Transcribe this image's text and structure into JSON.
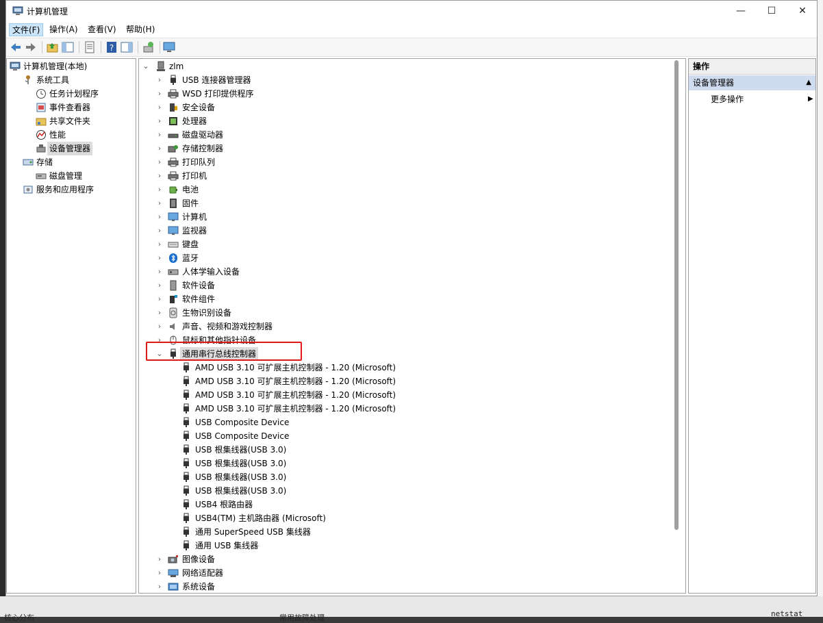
{
  "window": {
    "title": "计算机管理"
  },
  "menu": [
    "文件(F)",
    "操作(A)",
    "查看(V)",
    "帮助(H)"
  ],
  "left_tree": [
    {
      "label": "计算机管理(本地)",
      "indent": 0,
      "arrow": "",
      "icon": "computer-management-icon"
    },
    {
      "label": "系统工具",
      "indent": 1,
      "arrow": "⌄",
      "icon": "tools-icon"
    },
    {
      "label": "任务计划程序",
      "indent": 2,
      "arrow": "›",
      "icon": "clock-icon"
    },
    {
      "label": "事件查看器",
      "indent": 2,
      "arrow": "›",
      "icon": "event-viewer-icon"
    },
    {
      "label": "共享文件夹",
      "indent": 2,
      "arrow": "›",
      "icon": "shared-folder-icon"
    },
    {
      "label": "性能",
      "indent": 2,
      "arrow": "›",
      "icon": "performance-icon"
    },
    {
      "label": "设备管理器",
      "indent": 2,
      "arrow": "",
      "icon": "device-manager-icon",
      "selected": true
    },
    {
      "label": "存储",
      "indent": 1,
      "arrow": "⌄",
      "icon": "storage-icon"
    },
    {
      "label": "磁盘管理",
      "indent": 2,
      "arrow": "",
      "icon": "disk-management-icon"
    },
    {
      "label": "服务和应用程序",
      "indent": 1,
      "arrow": "›",
      "icon": "services-icon"
    }
  ],
  "device_tree": [
    {
      "label": "zlm",
      "level": 0,
      "arrow": "⌄",
      "icon": "computer-icon"
    },
    {
      "label": "USB 连接器管理器",
      "level": 1,
      "arrow": "›",
      "icon": "usb-icon"
    },
    {
      "label": "WSD 打印提供程序",
      "level": 1,
      "arrow": "›",
      "icon": "printer-icon"
    },
    {
      "label": "安全设备",
      "level": 1,
      "arrow": "›",
      "icon": "security-device-icon"
    },
    {
      "label": "处理器",
      "level": 1,
      "arrow": "›",
      "icon": "processor-icon"
    },
    {
      "label": "磁盘驱动器",
      "level": 1,
      "arrow": "›",
      "icon": "disk-drive-icon"
    },
    {
      "label": "存储控制器",
      "level": 1,
      "arrow": "›",
      "icon": "storage-controller-icon"
    },
    {
      "label": "打印队列",
      "level": 1,
      "arrow": "›",
      "icon": "printer-icon"
    },
    {
      "label": "打印机",
      "level": 1,
      "arrow": "›",
      "icon": "printer-icon"
    },
    {
      "label": "电池",
      "level": 1,
      "arrow": "›",
      "icon": "battery-icon"
    },
    {
      "label": "固件",
      "level": 1,
      "arrow": "›",
      "icon": "firmware-icon"
    },
    {
      "label": "计算机",
      "level": 1,
      "arrow": "›",
      "icon": "monitor-icon"
    },
    {
      "label": "监视器",
      "level": 1,
      "arrow": "›",
      "icon": "monitor-icon"
    },
    {
      "label": "键盘",
      "level": 1,
      "arrow": "›",
      "icon": "keyboard-icon"
    },
    {
      "label": "蓝牙",
      "level": 1,
      "arrow": "›",
      "icon": "bluetooth-icon"
    },
    {
      "label": "人体学输入设备",
      "level": 1,
      "arrow": "›",
      "icon": "hid-icon"
    },
    {
      "label": "软件设备",
      "level": 1,
      "arrow": "›",
      "icon": "software-device-icon"
    },
    {
      "label": "软件组件",
      "level": 1,
      "arrow": "›",
      "icon": "software-component-icon"
    },
    {
      "label": "生物识别设备",
      "level": 1,
      "arrow": "›",
      "icon": "fingerprint-icon"
    },
    {
      "label": "声音、视频和游戏控制器",
      "level": 1,
      "arrow": "›",
      "icon": "speaker-icon"
    },
    {
      "label": "鼠标和其他指针设备",
      "level": 1,
      "arrow": "›",
      "icon": "mouse-icon"
    },
    {
      "label": "通用串行总线控制器",
      "level": 1,
      "arrow": "⌄",
      "icon": "usb-icon",
      "selected": true
    },
    {
      "label": "AMD USB 3.10 可扩展主机控制器 - 1.20 (Microsoft)",
      "level": 2,
      "arrow": "",
      "icon": "usb-icon"
    },
    {
      "label": "AMD USB 3.10 可扩展主机控制器 - 1.20 (Microsoft)",
      "level": 2,
      "arrow": "",
      "icon": "usb-icon"
    },
    {
      "label": "AMD USB 3.10 可扩展主机控制器 - 1.20 (Microsoft)",
      "level": 2,
      "arrow": "",
      "icon": "usb-icon"
    },
    {
      "label": "AMD USB 3.10 可扩展主机控制器 - 1.20 (Microsoft)",
      "level": 2,
      "arrow": "",
      "icon": "usb-icon"
    },
    {
      "label": "USB Composite Device",
      "level": 2,
      "arrow": "",
      "icon": "usb-icon"
    },
    {
      "label": "USB Composite Device",
      "level": 2,
      "arrow": "",
      "icon": "usb-icon"
    },
    {
      "label": "USB 根集线器(USB 3.0)",
      "level": 2,
      "arrow": "",
      "icon": "usb-icon"
    },
    {
      "label": "USB 根集线器(USB 3.0)",
      "level": 2,
      "arrow": "",
      "icon": "usb-icon"
    },
    {
      "label": "USB 根集线器(USB 3.0)",
      "level": 2,
      "arrow": "",
      "icon": "usb-icon"
    },
    {
      "label": "USB 根集线器(USB 3.0)",
      "level": 2,
      "arrow": "",
      "icon": "usb-icon"
    },
    {
      "label": "USB4 根路由器",
      "level": 2,
      "arrow": "",
      "icon": "usb-icon"
    },
    {
      "label": "USB4(TM) 主机路由器 (Microsoft)",
      "level": 2,
      "arrow": "",
      "icon": "usb-icon"
    },
    {
      "label": "通用 SuperSpeed USB 集线器",
      "level": 2,
      "arrow": "",
      "icon": "usb-icon"
    },
    {
      "label": "通用 USB 集线器",
      "level": 2,
      "arrow": "",
      "icon": "usb-icon"
    },
    {
      "label": "图像设备",
      "level": 1,
      "arrow": "›",
      "icon": "camera-icon"
    },
    {
      "label": "网络适配器",
      "level": 1,
      "arrow": "›",
      "icon": "network-adapter-icon"
    },
    {
      "label": "系统设备",
      "level": 1,
      "arrow": "›",
      "icon": "system-device-icon"
    }
  ],
  "actions": {
    "header": "操作",
    "section": "设备管理器",
    "more": "更多操作"
  },
  "background": {
    "taskbar_text": "常用故障处理",
    "taskbar_left": "核心分布",
    "terminal_text": "netstat"
  }
}
